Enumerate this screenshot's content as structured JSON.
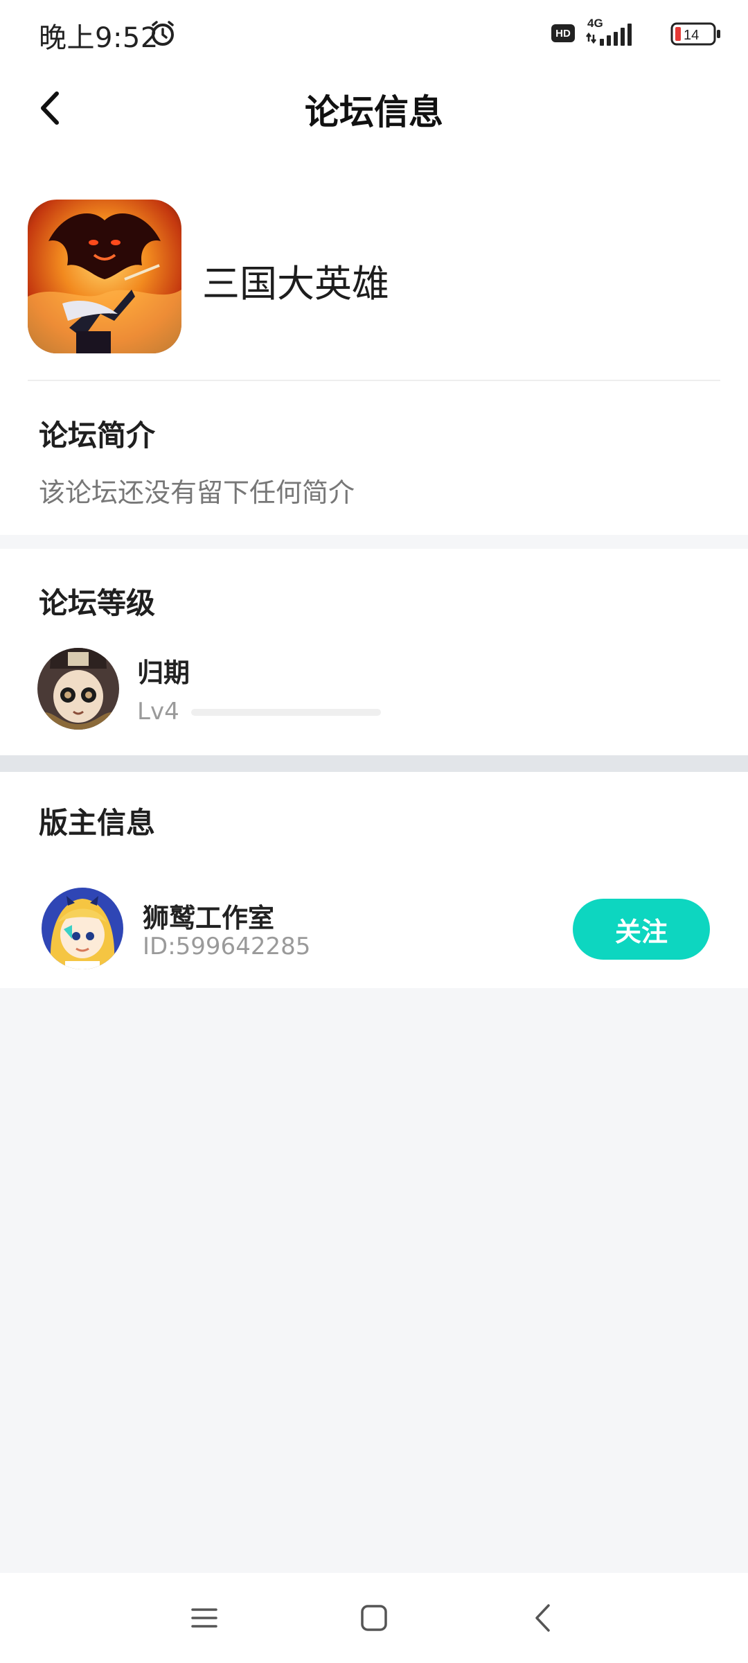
{
  "status_bar": {
    "time": "晚上9:52",
    "network": "4G",
    "hd": "HD",
    "battery": "14",
    "icons": [
      "alarm-icon",
      "hd-icon",
      "signal-icon",
      "battery-icon"
    ]
  },
  "header": {
    "title": "论坛信息",
    "back_icon": "back-arrow-icon"
  },
  "forum": {
    "name": "三国大英雄",
    "icon": "game-cover-image"
  },
  "intro": {
    "title": "论坛简介",
    "text": "该论坛还没有留下任何简介"
  },
  "level": {
    "title": "论坛等级",
    "user_name": "归期",
    "level_label": "Lv4",
    "progress": 0
  },
  "moderator": {
    "title": "版主信息",
    "name": "狮鹫工作室",
    "id": "ID:599642285",
    "follow_label": "关注"
  },
  "colors": {
    "accent": "#0dd6c0",
    "background": "#f5f6f8",
    "battery_low": "#e53935"
  },
  "nav_bar": {
    "icons": [
      "menu-icon",
      "home-icon",
      "back-icon"
    ]
  }
}
